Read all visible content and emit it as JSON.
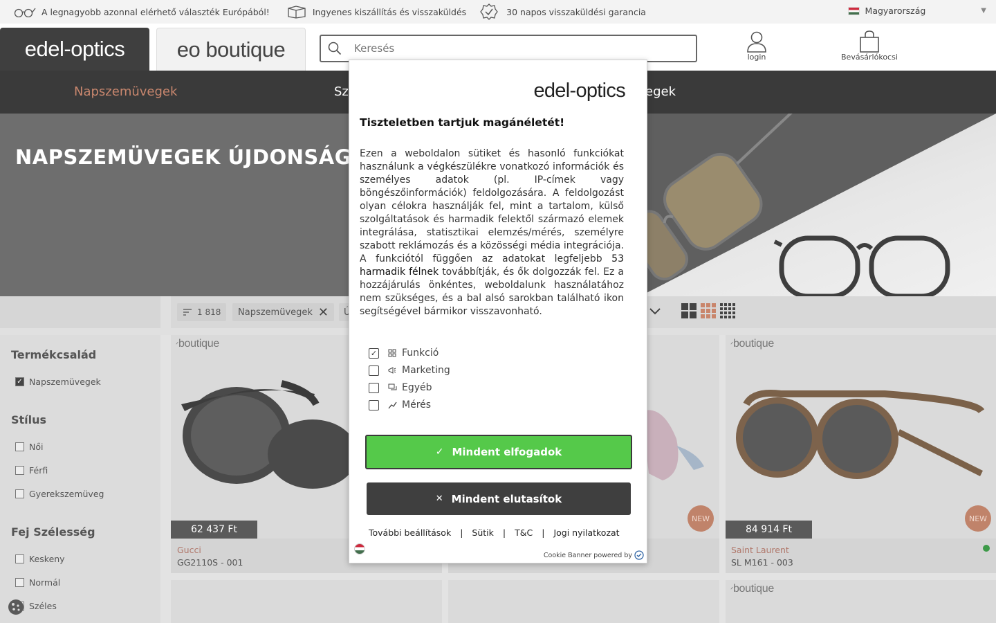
{
  "topbar": {
    "info1": "A legnagyobb azonnal elérhető választék Európából!",
    "info2": "Ingyenes kiszállítás és visszaküldés",
    "info3": "30 napos visszaküldési garancia",
    "country": "Magyarország"
  },
  "header": {
    "tab_main": "edel-optics",
    "tab_boutique": "eo boutique",
    "search_placeholder": "Keresés",
    "login": "login",
    "cart": "Bevásárlókocsi"
  },
  "nav": {
    "item1": "Napszemüvegek",
    "item2": "Sz",
    "item3": "egek"
  },
  "hero": {
    "title": "NAPSZEMÜVEGEK ÚJDONSÁGO"
  },
  "toolbar": {
    "count": "1 818",
    "chip_filter": "Napszemüvegek",
    "chip_partial": "Ú"
  },
  "sidebar": {
    "family_title": "Termékcsalád",
    "family_opt1": "Napszemüvegek",
    "style_title": "Stílus",
    "style_opt1": "Női",
    "style_opt2": "Férfi",
    "style_opt3": "Gyerekszemüveg",
    "head_title": "Fej Szélesség",
    "head_opt1": "Keskeny",
    "head_opt2": "Normál",
    "head_opt3": "Széles"
  },
  "products": [
    {
      "logo": "boutique",
      "price": "62 437 Ft",
      "brand": "Gucci",
      "model": "GG2110S - 001"
    },
    {
      "badge": "NEW"
    },
    {
      "logo": "boutique",
      "price": "84 914 Ft",
      "badge": "NEW",
      "brand": "Saint Laurent",
      "model": "SL M161 - 003"
    },
    {
      "logo": "boutique"
    }
  ],
  "modal": {
    "logo": "edel-optics",
    "title": "Tiszteletben tartjuk magánéletét!",
    "body_before": "Ezen a weboldalon sütiket és hasonló funkciókat használunk a végkészülékre vonatkozó információk és személyes adatok (pl. IP-címek vagy böngészőinformációk) feldolgozására. A feldolgozást olyan célokra használják fel, mint a tartalom, külső szolgáltatások és harmadik felektől származó elemek integrálása, statisztikai elemzés/mérés, személyre szabott reklámozás és a közösségi média integrációja. A funkciótól függően az adatokat legfeljebb ",
    "body_link": "53 harmadik félnek",
    "body_after": " továbbítják, és ők dolgozzák fel. Ez a hozzájárulás önkéntes, weboldalunk használatához nem szükséges, és a bal alsó sarokban található ikon segítségével bármikor visszavonható.",
    "opt_function": "Funkció",
    "opt_marketing": "Marketing",
    "opt_other": "Egyéb",
    "opt_measure": "Mérés",
    "accept": "Mindent elfogadok",
    "reject": "Mindent elutasítok",
    "link_settings": "További beállítások",
    "link_cookies": "Sütik",
    "link_tc": "T&C",
    "link_legal": "Jogi nyilatkozat",
    "powered": "Cookie Banner powered by"
  }
}
